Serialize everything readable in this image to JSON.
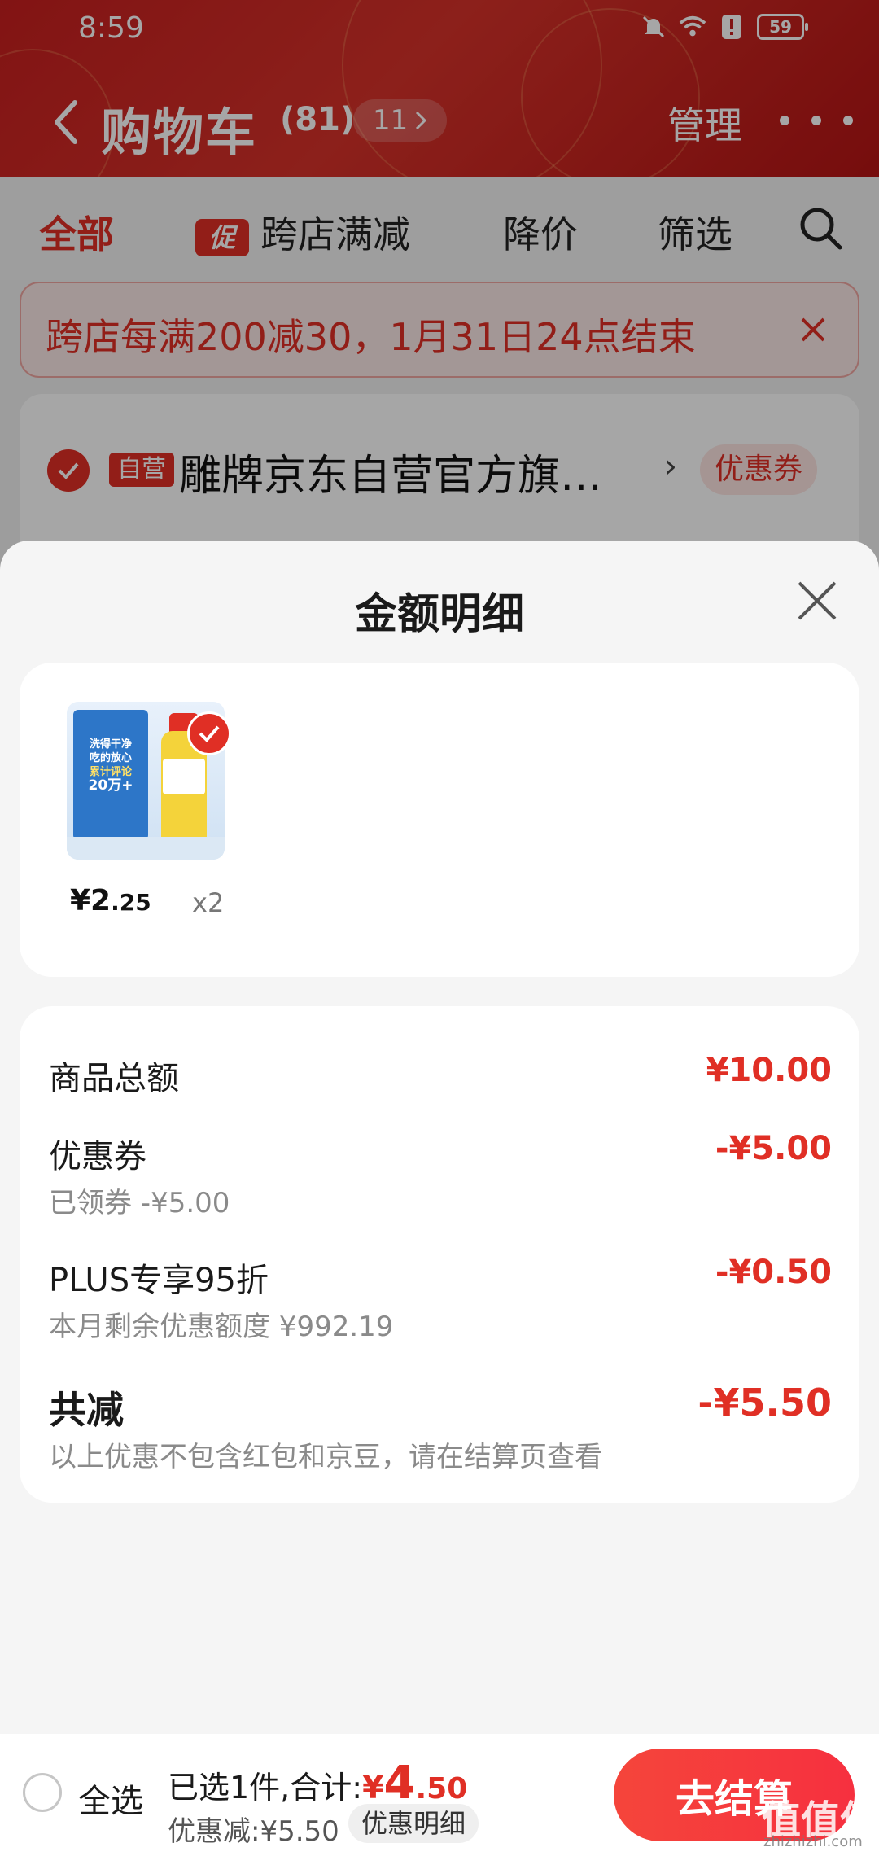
{
  "status_bar": {
    "time": "8:59",
    "battery": "59"
  },
  "header": {
    "title": "购物车",
    "count": "(81)",
    "pill": "11",
    "manage": "管理"
  },
  "tabs": {
    "all": "全部",
    "promo_icon": "促",
    "cross_store": "跨店满减",
    "price_drop": "降价",
    "filter": "筛选"
  },
  "banner": {
    "text": "跨店每满200减30，1月31日24点结束"
  },
  "store": {
    "self_tag": "自营",
    "name": "雕牌京东自营官方旗…",
    "coupon": "优惠券"
  },
  "sheet": {
    "title": "金额明细",
    "product": {
      "price_int": "¥2",
      "price_dec": ".25",
      "qty": "x2",
      "image_text": [
        "洗得干净",
        "吃的放心",
        "累计评论",
        "20万+"
      ]
    },
    "rows": {
      "total_label": "商品总额",
      "total_amount": "¥10.00",
      "coupon_label": "优惠券",
      "coupon_sub": "已领券 -¥5.00",
      "coupon_amount": "-¥5.00",
      "plus_label": "PLUS专享95折",
      "plus_sub": "本月剩余优惠额度 ¥992.19",
      "plus_amount": "-¥0.50",
      "reduce_label": "共减",
      "reduce_sub": "以上优惠不包含红包和京豆，请在结算页查看",
      "reduce_amount": "-¥5.50"
    }
  },
  "bottom": {
    "select_all": "全选",
    "summary_prefix": "已选1件,合计:",
    "summary_yen": "¥",
    "summary_int": "4",
    "summary_dec": ".50",
    "discount": "优惠减:¥5.50",
    "detail_link": "优惠明细",
    "checkout": "去结算"
  },
  "watermark": {
    "text": "值值值",
    "url": "zhizhizhi.com"
  },
  "colors": {
    "brand_red": "#e02f25",
    "header_red": "#c81f1f"
  }
}
